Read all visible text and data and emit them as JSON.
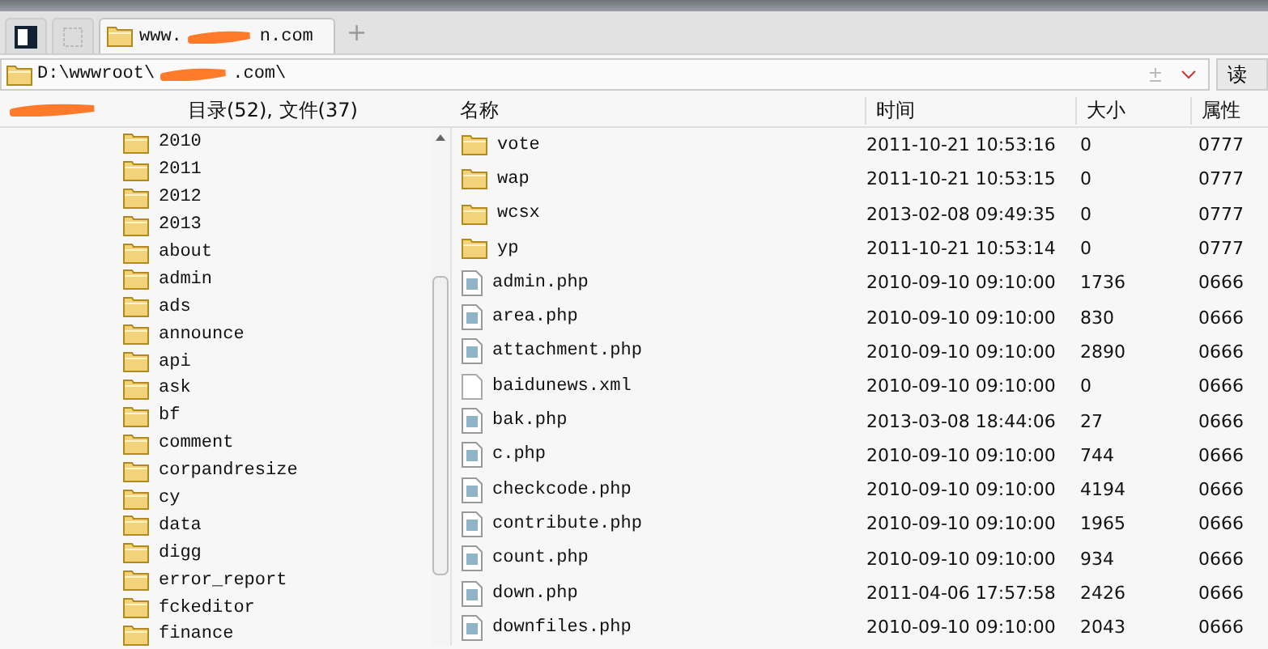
{
  "tabs": [
    {
      "kind": "panel",
      "selected": false
    },
    {
      "kind": "blank",
      "selected": false
    },
    {
      "kind": "folder",
      "title_start": "www.",
      "title_end": "n.com",
      "selected": true
    }
  ],
  "new_tab": "+",
  "address": {
    "path_start": "D:\\wwwroot\\",
    "path_end": ".com\\",
    "button": "读"
  },
  "left_header": {
    "stats": "目录(52), 文件(37)"
  },
  "tree": [
    "2010",
    "2011",
    "2012",
    "2013",
    "about",
    "admin",
    "ads",
    "announce",
    "api",
    "ask",
    "bf",
    "comment",
    "corpandresize",
    "cy",
    "data",
    "digg",
    "error_report",
    "fckeditor",
    "finance"
  ],
  "table": {
    "columns": [
      "名称",
      "时间",
      "大小",
      "属性"
    ],
    "rows": [
      {
        "kind": "folder",
        "name": "vote",
        "time": "2011-10-21 10:53:16",
        "size": "0",
        "attr": "0777"
      },
      {
        "kind": "folder",
        "name": "wap",
        "time": "2011-10-21 10:53:15",
        "size": "0",
        "attr": "0777"
      },
      {
        "kind": "folder",
        "name": "wcsx",
        "time": "2013-02-08 09:49:35",
        "size": "0",
        "attr": "0777"
      },
      {
        "kind": "folder",
        "name": "yp",
        "time": "2011-10-21 10:53:14",
        "size": "0",
        "attr": "0777"
      },
      {
        "kind": "script",
        "name": "admin.php",
        "time": "2010-09-10 09:10:00",
        "size": "1736",
        "attr": "0666"
      },
      {
        "kind": "script",
        "name": "area.php",
        "time": "2010-09-10 09:10:00",
        "size": "830",
        "attr": "0666"
      },
      {
        "kind": "script",
        "name": "attachment.php",
        "time": "2010-09-10 09:10:00",
        "size": "2890",
        "attr": "0666"
      },
      {
        "kind": "plain",
        "name": "baidunews.xml",
        "time": "2010-09-10 09:10:00",
        "size": "0",
        "attr": "0666"
      },
      {
        "kind": "script",
        "name": "bak.php",
        "time": "2013-03-08 18:44:06",
        "size": "27",
        "attr": "0666"
      },
      {
        "kind": "script",
        "name": "c.php",
        "time": "2010-09-10 09:10:00",
        "size": "744",
        "attr": "0666"
      },
      {
        "kind": "script",
        "name": "checkcode.php",
        "time": "2010-09-10 09:10:00",
        "size": "4194",
        "attr": "0666"
      },
      {
        "kind": "script",
        "name": "contribute.php",
        "time": "2010-09-10 09:10:00",
        "size": "1965",
        "attr": "0666"
      },
      {
        "kind": "script",
        "name": "count.php",
        "time": "2010-09-10 09:10:00",
        "size": "934",
        "attr": "0666"
      },
      {
        "kind": "script",
        "name": "down.php",
        "time": "2011-04-06 17:57:58",
        "size": "2426",
        "attr": "0666"
      },
      {
        "kind": "script",
        "name": "downfiles.php",
        "time": "2010-09-10 09:10:00",
        "size": "2043",
        "attr": "0666"
      }
    ]
  }
}
